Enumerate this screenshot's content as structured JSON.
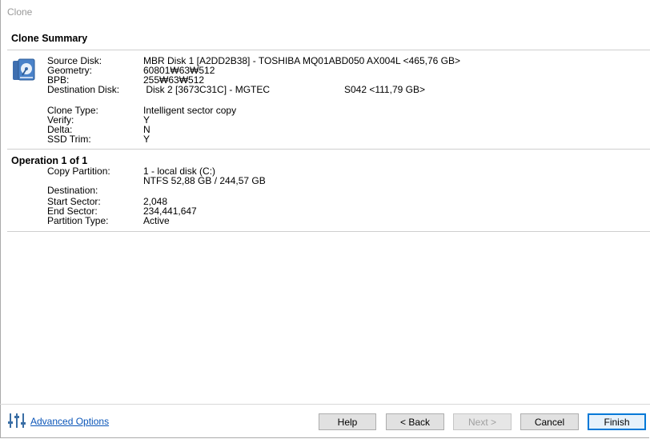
{
  "window": {
    "title": "Clone"
  },
  "summary": {
    "heading": "Clone Summary",
    "rows": [
      {
        "label": "Source Disk:",
        "value": "MBR Disk 1 [A2DD2B38] - TOSHIBA MQ01ABD050 AX004L  <465,76 GB>"
      },
      {
        "label": "Geometry:",
        "value": "60801₩63₩512"
      },
      {
        "label": "BPB:",
        "value": "255₩63₩512"
      },
      {
        "label": "Destination Disk:",
        "value": " Disk 2 [3673C31C] - MGTEC"
      },
      {
        "label": "Clone Type:",
        "value": "Intelligent sector copy"
      },
      {
        "label": "Verify:",
        "value": "Y"
      },
      {
        "label": "Delta:",
        "value": "N"
      },
      {
        "label": "SSD Trim:",
        "value": "Y"
      }
    ],
    "destination_extra": "S042  <111,79 GB>"
  },
  "operation": {
    "heading": "Operation 1 of 1",
    "rows": [
      {
        "label": "Copy Partition:",
        "value": "1 - local disk (C:)"
      },
      {
        "label": "",
        "value": "NTFS 52,88 GB / 244,57 GB"
      },
      {
        "label": "Destination:",
        "value": ""
      },
      {
        "label": "Start Sector:",
        "value": "2,048"
      },
      {
        "label": "End Sector:",
        "value": "234,441,647"
      },
      {
        "label": "Partition Type:",
        "value": "Active"
      }
    ]
  },
  "footer": {
    "advanced_options": "Advanced Options",
    "help": "Help",
    "back": "< Back",
    "next": "Next >",
    "cancel": "Cancel",
    "finish": "Finish"
  },
  "colors": {
    "link": "#0a55b8",
    "default_button_border": "#0078d7"
  },
  "icons": {
    "disk": "disk-clone-icon",
    "advanced": "sliders-icon"
  }
}
